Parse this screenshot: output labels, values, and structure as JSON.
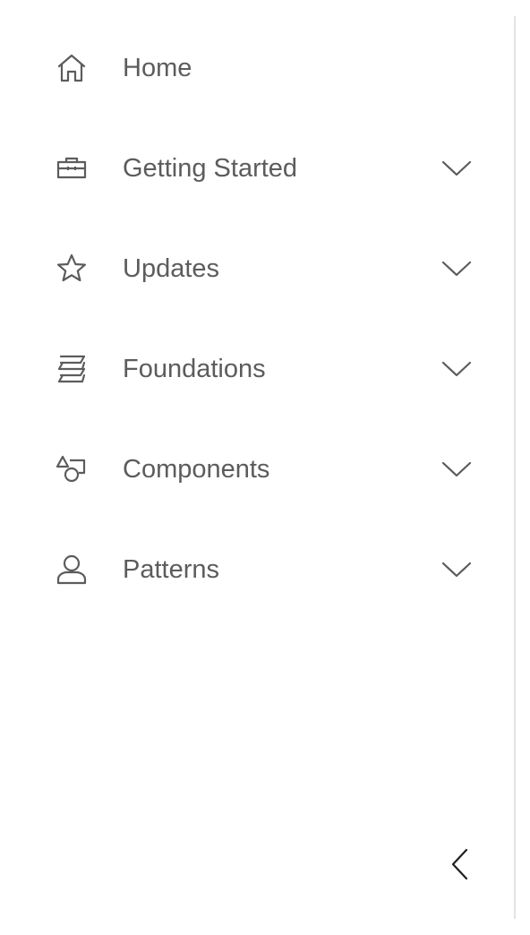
{
  "colors": {
    "text": "#5c5c5c",
    "icon": "#5c5c5c",
    "divider": "#e3e3e3",
    "background": "#ffffff"
  },
  "nav": {
    "items": [
      {
        "label": "Home",
        "icon": "home-icon",
        "expandable": false
      },
      {
        "label": "Getting Started",
        "icon": "toolbox-icon",
        "expandable": true
      },
      {
        "label": "Updates",
        "icon": "star-icon",
        "expandable": true
      },
      {
        "label": "Foundations",
        "icon": "layers-icon",
        "expandable": true
      },
      {
        "label": "Components",
        "icon": "shapes-icon",
        "expandable": true
      },
      {
        "label": "Patterns",
        "icon": "user-icon",
        "expandable": true
      }
    ],
    "collapse_icon": "chevron-left-icon",
    "expand_icon": "chevron-down-icon"
  }
}
